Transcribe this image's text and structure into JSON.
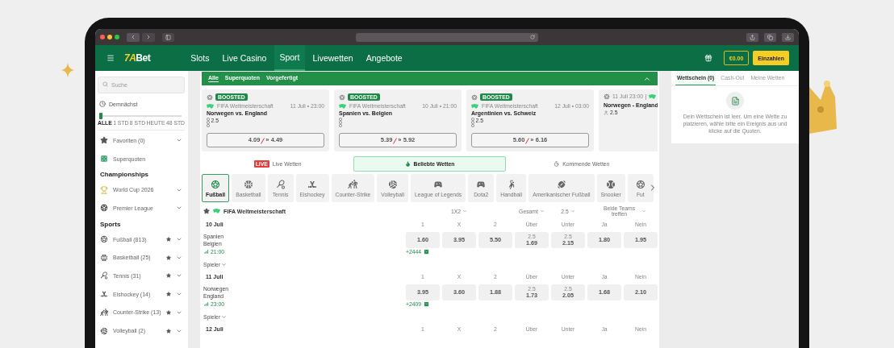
{
  "header": {
    "logo_accent": "7A",
    "logo_rest": "Bet",
    "nav": [
      {
        "label": "Slots",
        "selected": false
      },
      {
        "label": "Live Casino",
        "selected": false
      },
      {
        "label": "Sport",
        "selected": true
      },
      {
        "label": "Livewetten",
        "selected": false
      },
      {
        "label": "Angebote",
        "selected": false
      }
    ],
    "balance": "€0.00",
    "deposit": "Einzahlen"
  },
  "sidebar": {
    "search": {
      "placeholder": "Suche"
    },
    "upcoming": {
      "label": "Demnächst",
      "level": 0,
      "ticks": [
        {
          "label": "ALLE",
          "selected": true
        },
        {
          "label": "1 STD",
          "selected": false
        },
        {
          "label": "8 STD",
          "selected": false
        },
        {
          "label": "HEUTE",
          "selected": false
        },
        {
          "label": "48 STD",
          "selected": false
        }
      ]
    },
    "top_items": [
      {
        "kind": "dropdown",
        "label": "Favoriten (0)"
      },
      {
        "kind": "link",
        "label": "Superquoten"
      }
    ],
    "sections": [
      {
        "title": "Championships",
        "items": [
          {
            "kind": "dropdown",
            "label": "World Cup 2026"
          },
          {
            "kind": "dropdown",
            "label": "Premier League"
          }
        ]
      },
      {
        "title": "Sports",
        "items": [
          {
            "kind": "sport",
            "label": "Fußball (813)"
          },
          {
            "kind": "sport",
            "label": "Basketball (25)"
          },
          {
            "kind": "sport",
            "label": "Tennis (31)"
          },
          {
            "kind": "sport",
            "label": "Eishockey (14)"
          },
          {
            "kind": "sport",
            "label": "Counter-Strike (13)"
          },
          {
            "kind": "sport",
            "label": "Volleyball (2)"
          }
        ]
      }
    ]
  },
  "quick_filters": {
    "expanded": true,
    "items": [
      {
        "label": "Alle",
        "selected": true
      },
      {
        "label": "Superquoten",
        "selected": false
      },
      {
        "label": "Vorgefertigt",
        "selected": false
      }
    ]
  },
  "boosted": [
    {
      "kind": "boosted",
      "badge": "BOOSTED",
      "league": "FIFA Weltmeisterschaft",
      "date": "11 Juli • 23:00",
      "title": "Norwegen vs. England",
      "line": "2.5",
      "old_odds": "4.09",
      "separator": "»",
      "new_odds": "4.49"
    },
    {
      "kind": "boosted",
      "badge": "BOOSTED",
      "league": "FIFA Weltmeisterschaft",
      "date": "10 Juli • 21:00",
      "title": "Spanien vs. Belgien",
      "old_odds": "5.39",
      "separator": "»",
      "new_odds": "5.92"
    },
    {
      "kind": "boosted",
      "badge": "BOOSTED",
      "league": "FIFA Weltmeisterschaft",
      "date": "12 Juli • 03:00",
      "title": "Argentinien vs. Schweiz",
      "line": "2.5",
      "old_odds": "5.60",
      "separator": "»",
      "new_odds": "6.16"
    },
    {
      "kind": "compact",
      "date": "11 Juli 23:00",
      "title": "Norwegen - England",
      "line": "2.5"
    }
  ],
  "bet_tabs": [
    {
      "label": "Live Wetten",
      "badge": "LIVE",
      "selected": false
    },
    {
      "label": "Beliebte Wetten",
      "selected": true
    },
    {
      "label": "Kommende Wetten",
      "selected": false
    }
  ],
  "sports": [
    {
      "label": "Fußball",
      "selected": true
    },
    {
      "label": "Basketball",
      "selected": false
    },
    {
      "label": "Tennis",
      "selected": false
    },
    {
      "label": "Eishockey",
      "selected": false
    },
    {
      "label": "Counter-Strike",
      "selected": false
    },
    {
      "label": "Volleyball",
      "selected": false
    },
    {
      "label": "League of Legends",
      "selected": false
    },
    {
      "label": "Dota2",
      "selected": false
    },
    {
      "label": "Handball",
      "selected": false
    },
    {
      "label": "Amerikanischer Fußball",
      "selected": false
    },
    {
      "label": "Snooker",
      "selected": false
    },
    {
      "label": "Fut",
      "selected": false
    }
  ],
  "league": {
    "name": "FIFA Weltmeisterschaft",
    "markets": [
      "1X2",
      "Gesamt",
      "2.5",
      "Beide Teams treffen"
    ]
  },
  "days": [
    {
      "date": "10 Juli",
      "columns": [
        "1",
        "X",
        "2",
        "Über",
        "Unter",
        "Ja",
        "Nein"
      ],
      "matches": [
        {
          "home": "Spanien",
          "away": "Belgien",
          "time": "21:00",
          "more": "+2444",
          "players": "Spieler",
          "odds": [
            {
              "value": "1.60"
            },
            {
              "value": "3.95"
            },
            {
              "value": "5.50"
            },
            {
              "line": "2.5",
              "value": "1.69"
            },
            {
              "line": "2.5",
              "value": "2.15"
            },
            {
              "value": "1.80"
            },
            {
              "value": "1.95"
            }
          ]
        }
      ]
    },
    {
      "date": "11 Juli",
      "columns": [
        "1",
        "X",
        "2",
        "Über",
        "Unter",
        "Ja",
        "Nein"
      ],
      "matches": [
        {
          "home": "Norwegen",
          "away": "England",
          "time": "23:00",
          "more": "+2409",
          "players": "Spieler",
          "odds": [
            {
              "value": "3.95"
            },
            {
              "value": "3.60"
            },
            {
              "value": "1.88"
            },
            {
              "line": "2.5",
              "value": "1.73"
            },
            {
              "line": "2.5",
              "value": "2.05"
            },
            {
              "value": "1.68"
            },
            {
              "value": "2.10"
            }
          ]
        }
      ]
    },
    {
      "date": "12 Juli",
      "columns": [
        "1",
        "X",
        "2",
        "Über",
        "Unter",
        "Ja",
        "Nein"
      ]
    }
  ],
  "betslip": {
    "tabs": [
      {
        "label": "Wettschein (0)",
        "selected": true
      },
      {
        "label": "Cash-Out",
        "selected": false
      },
      {
        "label": "Meine Wetten",
        "selected": false
      }
    ],
    "message": "Dein Wettschein ist leer. Um eine Wette zu platzieren, wähle bitte ein Ereignis aus und klicke auf die Quoten."
  }
}
